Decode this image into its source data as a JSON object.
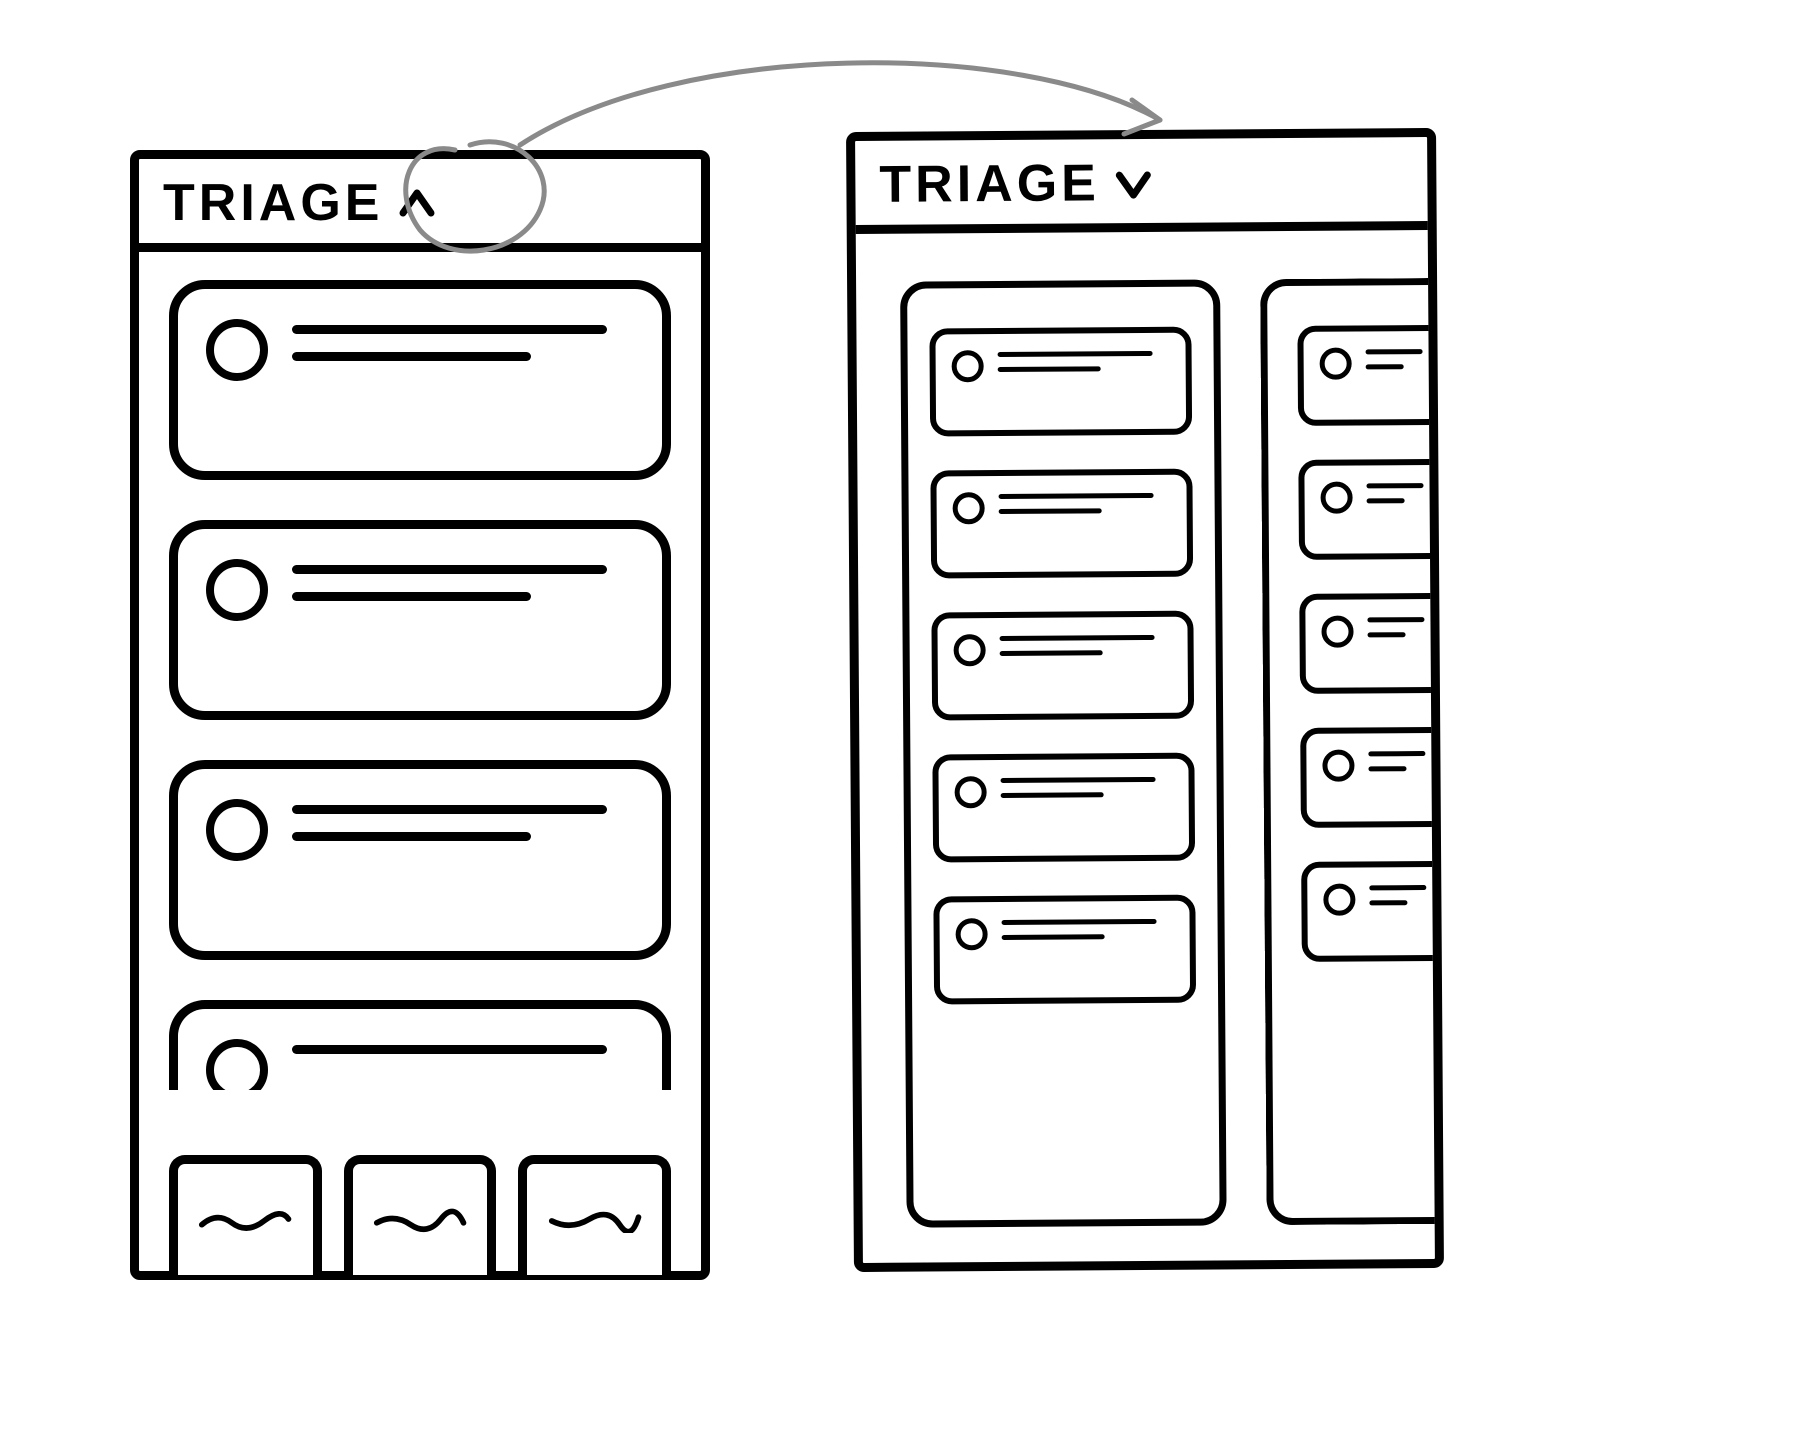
{
  "left_panel": {
    "title": "TRIAGE",
    "chevron": "up",
    "cards": [
      {
        "avatar": true,
        "lines": 2
      },
      {
        "avatar": true,
        "lines": 2
      },
      {
        "avatar": true,
        "lines": 2
      },
      {
        "avatar": true,
        "lines": 2,
        "partial": true
      }
    ],
    "tabs": [
      {
        "label_squiggle": true
      },
      {
        "label_squiggle": true
      },
      {
        "label_squiggle": true
      }
    ]
  },
  "right_panel": {
    "title": "TRIAGE",
    "chevron": "down",
    "columns": [
      {
        "cards": 5
      },
      {
        "cards": 5,
        "cropped": true
      }
    ]
  },
  "annotation": {
    "circle_target": "left_panel.chevron",
    "arrow_to": "right_panel"
  }
}
